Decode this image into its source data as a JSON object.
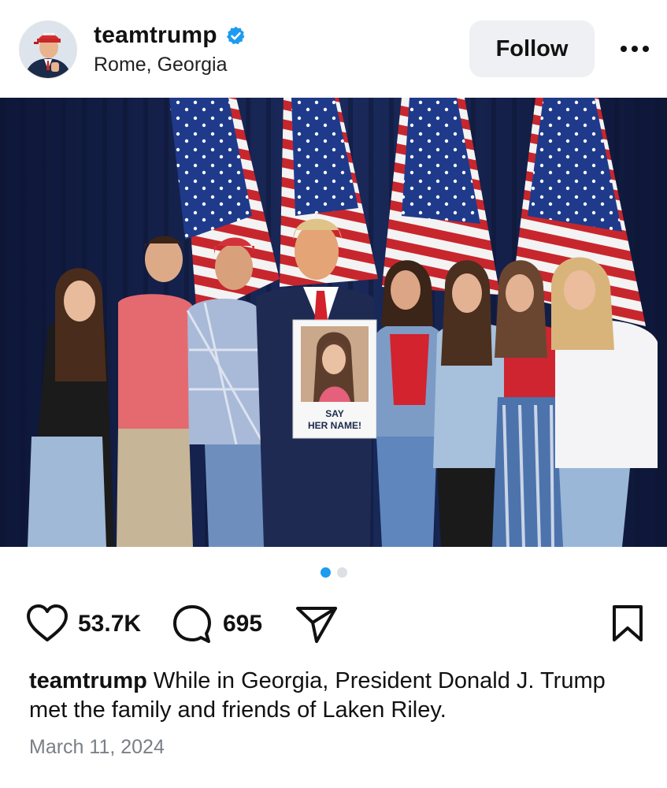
{
  "post": {
    "username": "teamtrump",
    "location": "Rome, Georgia",
    "follow_label": "Follow",
    "verified": true
  },
  "photo": {
    "sign_text_line1": "SAY",
    "sign_text_line2": "HER NAME!"
  },
  "carousel": {
    "current": 1,
    "total": 2
  },
  "engagement": {
    "likes": "53.7K",
    "comments": "695"
  },
  "caption": {
    "username": "teamtrump",
    "text": "While in Georgia, President Donald J. Trump met the family and friends of Laken Riley."
  },
  "date": "March 11, 2024",
  "icons": {
    "avatar": "profile-avatar",
    "verified": "verified-badge-icon",
    "more": "more-options-icon",
    "like": "heart-icon",
    "comment": "comment-icon",
    "share": "share-icon",
    "save": "bookmark-icon"
  },
  "colors": {
    "verified": "#1d9bf0",
    "follow_bg": "#eef0f3",
    "dot_active": "#1d9bf0",
    "date": "#7a7f86"
  }
}
